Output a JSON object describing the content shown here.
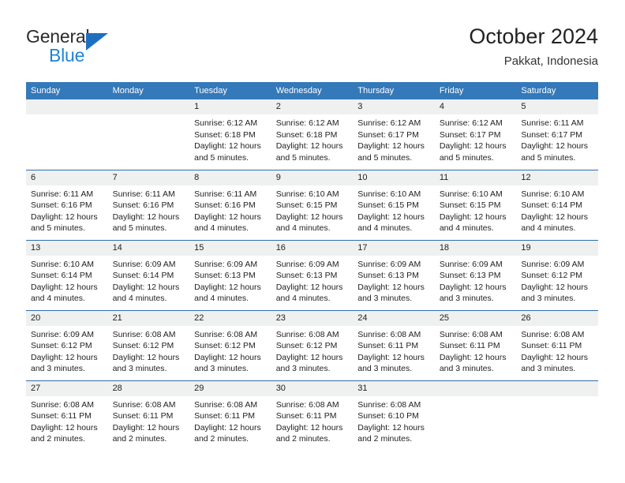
{
  "brand": {
    "name_part1": "General",
    "name_part2": "Blue",
    "triangle_icon": "triangle-icon",
    "accent_blue": "#1e84d6",
    "logo_triangle_color": "#1e6fc0"
  },
  "header": {
    "title": "October 2024",
    "subtitle": "Pakkat, Indonesia",
    "header_bg": "#3479b9",
    "header_text_color": "#ffffff",
    "row_divider_color": "#2f6fad",
    "daynum_band_bg": "#eff0f0"
  },
  "weekday_headers": [
    "Sunday",
    "Monday",
    "Tuesday",
    "Wednesday",
    "Thursday",
    "Friday",
    "Saturday"
  ],
  "labels": {
    "sunrise_prefix": "Sunrise:",
    "sunset_prefix": "Sunset:",
    "daylight_prefix": "Daylight:"
  },
  "weeks": [
    [
      {
        "day": "",
        "empty": true,
        "sunrise": "",
        "sunset": "",
        "daylight_line1": "",
        "daylight_line2": ""
      },
      {
        "day": "",
        "empty": true,
        "sunrise": "",
        "sunset": "",
        "daylight_line1": "",
        "daylight_line2": ""
      },
      {
        "day": "1",
        "empty": false,
        "sunrise": "Sunrise: 6:12 AM",
        "sunset": "Sunset: 6:18 PM",
        "daylight_line1": "Daylight: 12 hours",
        "daylight_line2": "and 5 minutes."
      },
      {
        "day": "2",
        "empty": false,
        "sunrise": "Sunrise: 6:12 AM",
        "sunset": "Sunset: 6:18 PM",
        "daylight_line1": "Daylight: 12 hours",
        "daylight_line2": "and 5 minutes."
      },
      {
        "day": "3",
        "empty": false,
        "sunrise": "Sunrise: 6:12 AM",
        "sunset": "Sunset: 6:17 PM",
        "daylight_line1": "Daylight: 12 hours",
        "daylight_line2": "and 5 minutes."
      },
      {
        "day": "4",
        "empty": false,
        "sunrise": "Sunrise: 6:12 AM",
        "sunset": "Sunset: 6:17 PM",
        "daylight_line1": "Daylight: 12 hours",
        "daylight_line2": "and 5 minutes."
      },
      {
        "day": "5",
        "empty": false,
        "sunrise": "Sunrise: 6:11 AM",
        "sunset": "Sunset: 6:17 PM",
        "daylight_line1": "Daylight: 12 hours",
        "daylight_line2": "and 5 minutes."
      }
    ],
    [
      {
        "day": "6",
        "empty": false,
        "sunrise": "Sunrise: 6:11 AM",
        "sunset": "Sunset: 6:16 PM",
        "daylight_line1": "Daylight: 12 hours",
        "daylight_line2": "and 5 minutes."
      },
      {
        "day": "7",
        "empty": false,
        "sunrise": "Sunrise: 6:11 AM",
        "sunset": "Sunset: 6:16 PM",
        "daylight_line1": "Daylight: 12 hours",
        "daylight_line2": "and 5 minutes."
      },
      {
        "day": "8",
        "empty": false,
        "sunrise": "Sunrise: 6:11 AM",
        "sunset": "Sunset: 6:16 PM",
        "daylight_line1": "Daylight: 12 hours",
        "daylight_line2": "and 4 minutes."
      },
      {
        "day": "9",
        "empty": false,
        "sunrise": "Sunrise: 6:10 AM",
        "sunset": "Sunset: 6:15 PM",
        "daylight_line1": "Daylight: 12 hours",
        "daylight_line2": "and 4 minutes."
      },
      {
        "day": "10",
        "empty": false,
        "sunrise": "Sunrise: 6:10 AM",
        "sunset": "Sunset: 6:15 PM",
        "daylight_line1": "Daylight: 12 hours",
        "daylight_line2": "and 4 minutes."
      },
      {
        "day": "11",
        "empty": false,
        "sunrise": "Sunrise: 6:10 AM",
        "sunset": "Sunset: 6:15 PM",
        "daylight_line1": "Daylight: 12 hours",
        "daylight_line2": "and 4 minutes."
      },
      {
        "day": "12",
        "empty": false,
        "sunrise": "Sunrise: 6:10 AM",
        "sunset": "Sunset: 6:14 PM",
        "daylight_line1": "Daylight: 12 hours",
        "daylight_line2": "and 4 minutes."
      }
    ],
    [
      {
        "day": "13",
        "empty": false,
        "sunrise": "Sunrise: 6:10 AM",
        "sunset": "Sunset: 6:14 PM",
        "daylight_line1": "Daylight: 12 hours",
        "daylight_line2": "and 4 minutes."
      },
      {
        "day": "14",
        "empty": false,
        "sunrise": "Sunrise: 6:09 AM",
        "sunset": "Sunset: 6:14 PM",
        "daylight_line1": "Daylight: 12 hours",
        "daylight_line2": "and 4 minutes."
      },
      {
        "day": "15",
        "empty": false,
        "sunrise": "Sunrise: 6:09 AM",
        "sunset": "Sunset: 6:13 PM",
        "daylight_line1": "Daylight: 12 hours",
        "daylight_line2": "and 4 minutes."
      },
      {
        "day": "16",
        "empty": false,
        "sunrise": "Sunrise: 6:09 AM",
        "sunset": "Sunset: 6:13 PM",
        "daylight_line1": "Daylight: 12 hours",
        "daylight_line2": "and 4 minutes."
      },
      {
        "day": "17",
        "empty": false,
        "sunrise": "Sunrise: 6:09 AM",
        "sunset": "Sunset: 6:13 PM",
        "daylight_line1": "Daylight: 12 hours",
        "daylight_line2": "and 3 minutes."
      },
      {
        "day": "18",
        "empty": false,
        "sunrise": "Sunrise: 6:09 AM",
        "sunset": "Sunset: 6:13 PM",
        "daylight_line1": "Daylight: 12 hours",
        "daylight_line2": "and 3 minutes."
      },
      {
        "day": "19",
        "empty": false,
        "sunrise": "Sunrise: 6:09 AM",
        "sunset": "Sunset: 6:12 PM",
        "daylight_line1": "Daylight: 12 hours",
        "daylight_line2": "and 3 minutes."
      }
    ],
    [
      {
        "day": "20",
        "empty": false,
        "sunrise": "Sunrise: 6:09 AM",
        "sunset": "Sunset: 6:12 PM",
        "daylight_line1": "Daylight: 12 hours",
        "daylight_line2": "and 3 minutes."
      },
      {
        "day": "21",
        "empty": false,
        "sunrise": "Sunrise: 6:08 AM",
        "sunset": "Sunset: 6:12 PM",
        "daylight_line1": "Daylight: 12 hours",
        "daylight_line2": "and 3 minutes."
      },
      {
        "day": "22",
        "empty": false,
        "sunrise": "Sunrise: 6:08 AM",
        "sunset": "Sunset: 6:12 PM",
        "daylight_line1": "Daylight: 12 hours",
        "daylight_line2": "and 3 minutes."
      },
      {
        "day": "23",
        "empty": false,
        "sunrise": "Sunrise: 6:08 AM",
        "sunset": "Sunset: 6:12 PM",
        "daylight_line1": "Daylight: 12 hours",
        "daylight_line2": "and 3 minutes."
      },
      {
        "day": "24",
        "empty": false,
        "sunrise": "Sunrise: 6:08 AM",
        "sunset": "Sunset: 6:11 PM",
        "daylight_line1": "Daylight: 12 hours",
        "daylight_line2": "and 3 minutes."
      },
      {
        "day": "25",
        "empty": false,
        "sunrise": "Sunrise: 6:08 AM",
        "sunset": "Sunset: 6:11 PM",
        "daylight_line1": "Daylight: 12 hours",
        "daylight_line2": "and 3 minutes."
      },
      {
        "day": "26",
        "empty": false,
        "sunrise": "Sunrise: 6:08 AM",
        "sunset": "Sunset: 6:11 PM",
        "daylight_line1": "Daylight: 12 hours",
        "daylight_line2": "and 3 minutes."
      }
    ],
    [
      {
        "day": "27",
        "empty": false,
        "sunrise": "Sunrise: 6:08 AM",
        "sunset": "Sunset: 6:11 PM",
        "daylight_line1": "Daylight: 12 hours",
        "daylight_line2": "and 2 minutes."
      },
      {
        "day": "28",
        "empty": false,
        "sunrise": "Sunrise: 6:08 AM",
        "sunset": "Sunset: 6:11 PM",
        "daylight_line1": "Daylight: 12 hours",
        "daylight_line2": "and 2 minutes."
      },
      {
        "day": "29",
        "empty": false,
        "sunrise": "Sunrise: 6:08 AM",
        "sunset": "Sunset: 6:11 PM",
        "daylight_line1": "Daylight: 12 hours",
        "daylight_line2": "and 2 minutes."
      },
      {
        "day": "30",
        "empty": false,
        "sunrise": "Sunrise: 6:08 AM",
        "sunset": "Sunset: 6:11 PM",
        "daylight_line1": "Daylight: 12 hours",
        "daylight_line2": "and 2 minutes."
      },
      {
        "day": "31",
        "empty": false,
        "sunrise": "Sunrise: 6:08 AM",
        "sunset": "Sunset: 6:10 PM",
        "daylight_line1": "Daylight: 12 hours",
        "daylight_line2": "and 2 minutes."
      },
      {
        "day": "",
        "empty": true,
        "sunrise": "",
        "sunset": "",
        "daylight_line1": "",
        "daylight_line2": ""
      },
      {
        "day": "",
        "empty": true,
        "sunrise": "",
        "sunset": "",
        "daylight_line1": "",
        "daylight_line2": ""
      }
    ]
  ]
}
